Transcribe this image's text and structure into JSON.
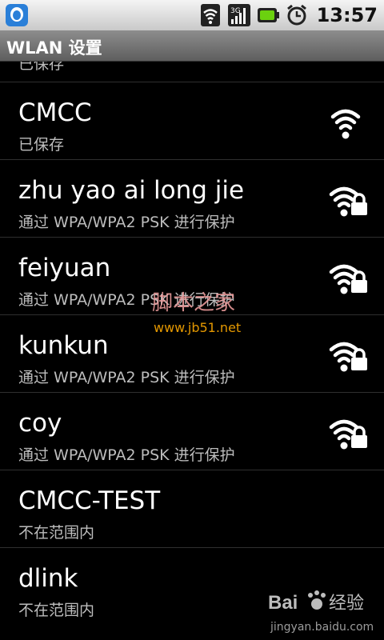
{
  "status_bar": {
    "time": "13:57",
    "icons": [
      "app-notification-icon",
      "wifi-icon",
      "cell-signal-icon",
      "battery-icon",
      "alarm-icon"
    ]
  },
  "title_bar": {
    "title": "WLAN 设置"
  },
  "list": {
    "partial_top_subtitle": "已保存",
    "networks": [
      {
        "name": "CMCC",
        "status": "已保存",
        "signal_icon": "wifi-open-icon"
      },
      {
        "name": "zhu yao ai long jie",
        "status": "通过 WPA/WPA2 PSK 进行保护",
        "signal_icon": "wifi-locked-icon"
      },
      {
        "name": "feiyuan",
        "status": "通过 WPA/WPA2 PSK 进行保护",
        "signal_icon": "wifi-locked-icon"
      },
      {
        "name": "kunkun",
        "status": "通过 WPA/WPA2 PSK 进行保护",
        "signal_icon": "wifi-locked-icon"
      },
      {
        "name": "coy",
        "status": "通过 WPA/WPA2 PSK 进行保护",
        "signal_icon": "wifi-locked-icon"
      },
      {
        "name": "CMCC-TEST",
        "status": "不在范围内",
        "signal_icon": ""
      },
      {
        "name": "dlink",
        "status": "不在范围内",
        "signal_icon": ""
      }
    ]
  },
  "watermarks": {
    "jb51_cn": "脚本之家",
    "jb51_url": "www.jb51.net",
    "baidu_logo_text": "Baidu经验",
    "baidu_url": "jingyan.baidu.com"
  }
}
